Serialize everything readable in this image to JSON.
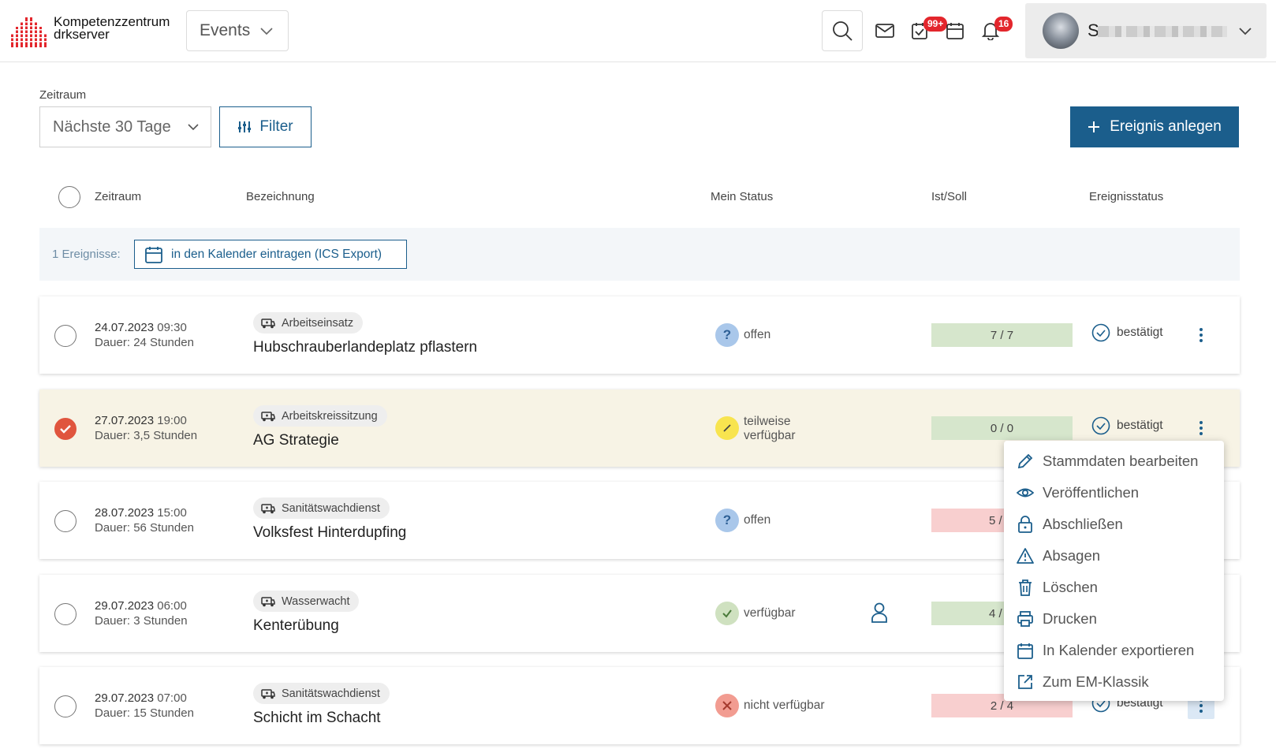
{
  "header": {
    "brand_line1": "Kompetenzzentrum",
    "brand_line2": "drkserver",
    "module_select": "Events",
    "tasks_badge": "99+",
    "notifications_badge": "16",
    "user_initial": "S"
  },
  "toolbar": {
    "period_label": "Zeitraum",
    "period_value": "Nächste 30 Tage",
    "filter_label": "Filter",
    "create_label": "Ereignis anlegen"
  },
  "table": {
    "columns": [
      "Zeitraum",
      "Bezeichnung",
      "Mein Status",
      "Ist/Soll",
      "Ereignisstatus"
    ],
    "export_count": "1 Ereignisse:",
    "export_label": "in den Kalender eintragen (ICS Export)",
    "rows": [
      {
        "date": "24.07.2023",
        "time": "09:30",
        "duration": "Dauer: 24 Stunden",
        "category": "Arbeitseinsatz",
        "title": "Hubschrauberlandeplatz pflastern",
        "status": "offen",
        "status_line2": "",
        "ist_soll": "7 / 7",
        "event_status": "bestätigt"
      },
      {
        "date": "27.07.2023",
        "time": "19:00",
        "duration": "Dauer: 3,5 Stunden",
        "category": "Arbeitskreissitzung",
        "title": "AG Strategie",
        "status": "teilweise",
        "status_line2": "verfügbar",
        "ist_soll": "0 / 0",
        "event_status": "bestätigt"
      },
      {
        "date": "28.07.2023",
        "time": "15:00",
        "duration": "Dauer: 56 Stunden",
        "category": "Sanitätswachdienst",
        "title": "Volksfest Hinterdupfing",
        "status": "offen",
        "status_line2": "",
        "ist_soll": "5 /",
        "event_status": ""
      },
      {
        "date": "29.07.2023",
        "time": "06:00",
        "duration": "Dauer: 3 Stunden",
        "category": "Wasserwacht",
        "title": "Kenterübung",
        "status": "verfügbar",
        "status_line2": "",
        "ist_soll": "4 /",
        "event_status": ""
      },
      {
        "date": "29.07.2023",
        "time": "07:00",
        "duration": "Dauer: 15 Stunden",
        "category": "Sanitätswachdienst",
        "title": "Schicht im Schacht",
        "status": "nicht verfügbar",
        "status_line2": "",
        "ist_soll": "2 / 4",
        "event_status": "bestätigt"
      }
    ]
  },
  "menu": {
    "items": [
      "Stammdaten bearbeiten",
      "Veröffentlichen",
      "Abschließen",
      "Absagen",
      "Löschen",
      "Drucken",
      "In Kalender exportieren",
      "Zum EM-Klassik"
    ]
  },
  "colors": {
    "primary": "#1b5e8c",
    "brand_red": "#e3262c",
    "selected_row": "#f7f3e5",
    "ok_bar": "#d6e6cc",
    "missing_bar": "#f8cfcf"
  }
}
